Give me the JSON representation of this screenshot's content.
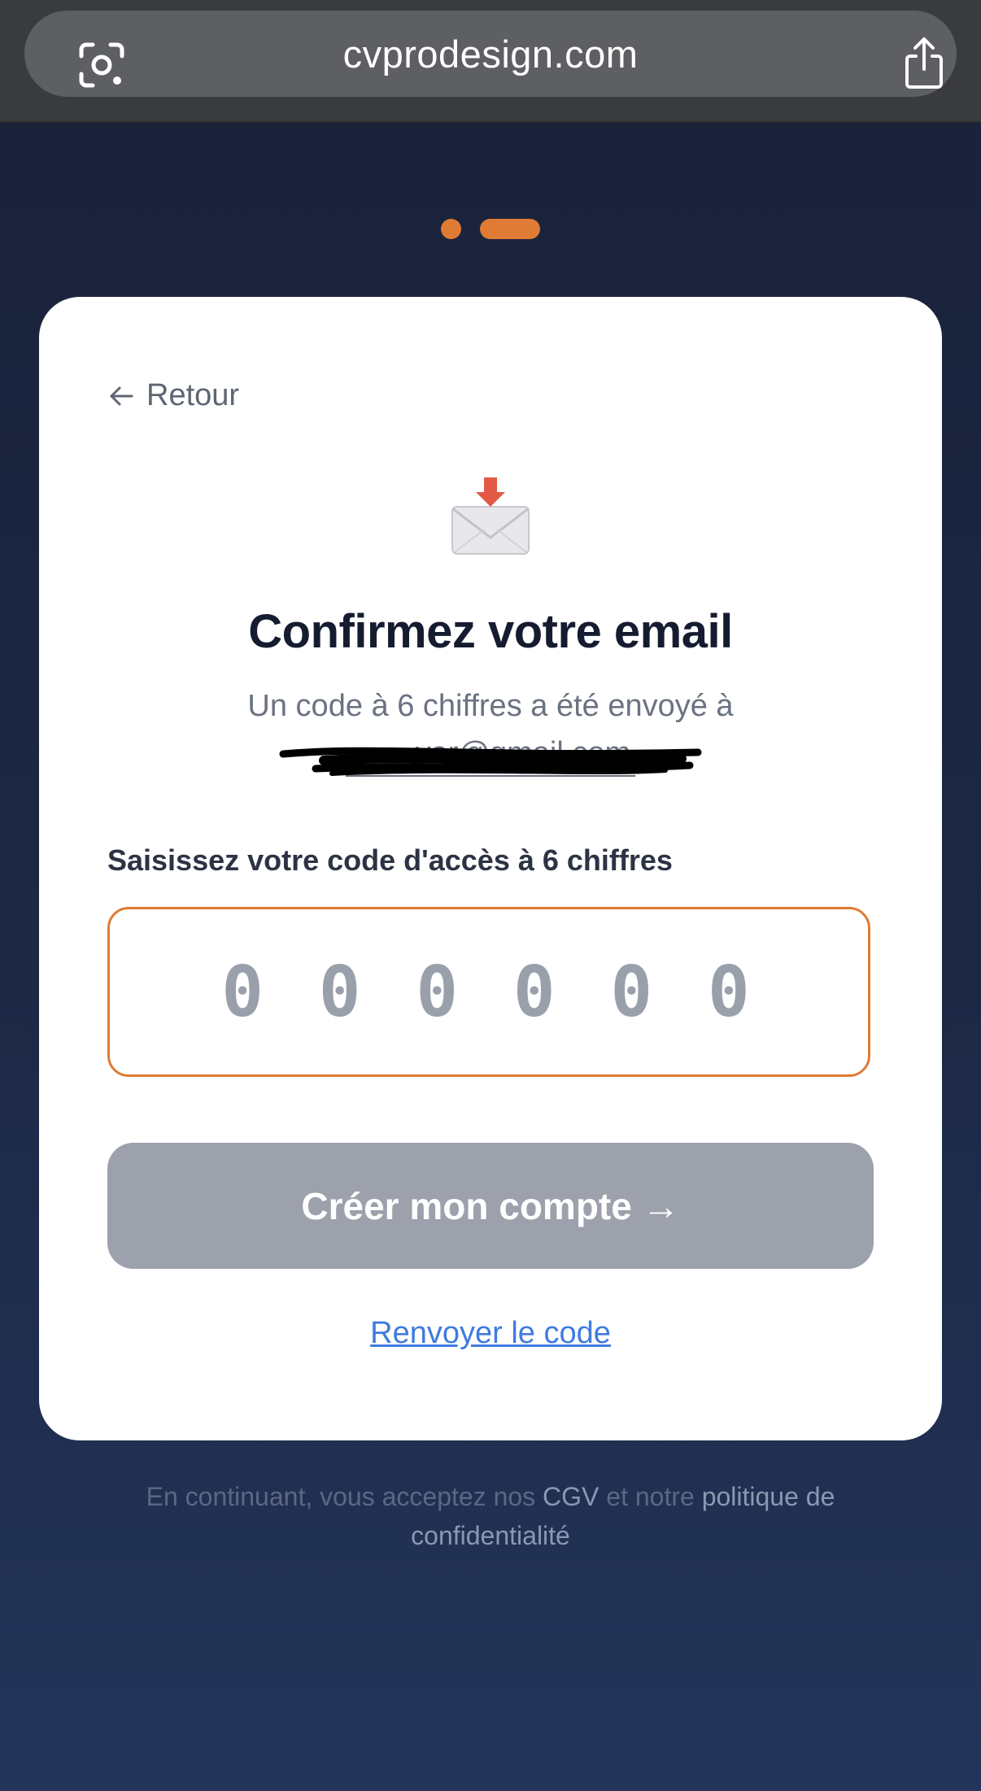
{
  "browser": {
    "url": "cvprodesign.com"
  },
  "progress": {
    "steps": 2,
    "current_step": 2
  },
  "card": {
    "back_label": "Retour",
    "title": "Confirmez votre email",
    "subtitle": "Un code à 6 chiffres a été envoyé à",
    "email": "••••••yar@gmail.com",
    "code_label": "Saisissez votre code d'accès à 6 chiffres",
    "code_placeholder": "0 0 0 0 0 0",
    "submit_label": "Créer mon compte →",
    "resend_label": "Renvoyer le code"
  },
  "footer": {
    "prefix": "En continuant, vous acceptez nos ",
    "cgv_label": "CGV",
    "middle": " et notre ",
    "privacy_label": "politique de confidentialité"
  },
  "colors": {
    "accent": "#e07b35",
    "button_disabled": "#9ca1ac",
    "link": "#3f7be0",
    "background": "#1a2239"
  }
}
